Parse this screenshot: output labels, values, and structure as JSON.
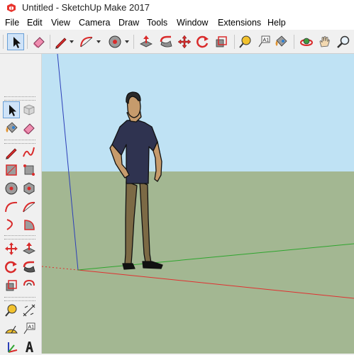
{
  "window": {
    "title": "Untitled - SketchUp Make 2017"
  },
  "menu": {
    "items": [
      "File",
      "Edit",
      "View",
      "Camera",
      "Draw",
      "Tools",
      "Window",
      "Extensions",
      "Help"
    ]
  },
  "toolbar": {
    "tools": [
      {
        "icon": "select-arrow-icon",
        "active": true
      },
      {
        "icon": "eraser-icon"
      },
      {
        "icon": "line-pencil-icon",
        "dropdown": true
      },
      {
        "icon": "arc-icon",
        "dropdown": true
      },
      {
        "icon": "shapes-icon",
        "dropdown": true
      },
      {
        "icon": "push-pull-icon"
      },
      {
        "icon": "follow-me-icon"
      },
      {
        "icon": "move-icon"
      },
      {
        "icon": "rotate-icon"
      },
      {
        "icon": "scale-icon"
      },
      {
        "icon": "tape-measure-icon"
      },
      {
        "icon": "text-icon"
      },
      {
        "icon": "paint-bucket-icon"
      },
      {
        "icon": "orbit-icon"
      },
      {
        "icon": "pan-hand-icon"
      },
      {
        "icon": "zoom-icon"
      }
    ]
  },
  "left_toolbar": {
    "tools": [
      {
        "icon": "select-arrow-icon",
        "active": true
      },
      {
        "icon": "make-component-icon"
      },
      {
        "icon": "paint-bucket-icon"
      },
      {
        "icon": "eraser-icon"
      },
      {
        "icon": "line-pencil-icon"
      },
      {
        "icon": "freehand-icon"
      },
      {
        "icon": "rectangle-icon"
      },
      {
        "icon": "rotated-rectangle-icon"
      },
      {
        "icon": "circle-icon"
      },
      {
        "icon": "polygon-icon"
      },
      {
        "icon": "arc-icon"
      },
      {
        "icon": "two-point-arc-icon"
      },
      {
        "icon": "three-point-arc-icon"
      },
      {
        "icon": "pie-icon"
      },
      {
        "icon": "move-icon"
      },
      {
        "icon": "push-pull-icon"
      },
      {
        "icon": "rotate-icon"
      },
      {
        "icon": "follow-me-icon"
      },
      {
        "icon": "scale-icon"
      },
      {
        "icon": "offset-icon"
      },
      {
        "icon": "tape-measure-icon"
      },
      {
        "icon": "dimension-icon"
      },
      {
        "icon": "protractor-icon"
      },
      {
        "icon": "text-icon"
      },
      {
        "icon": "axes-icon"
      },
      {
        "icon": "3d-text-icon"
      }
    ]
  },
  "viewport": {
    "sky_color": "#bfe2f4",
    "ground_color": "#a3b792",
    "red_axis_color": "#e03030",
    "green_axis_color": "#2ea52e",
    "blue_axis_color": "#2c3fb8"
  }
}
